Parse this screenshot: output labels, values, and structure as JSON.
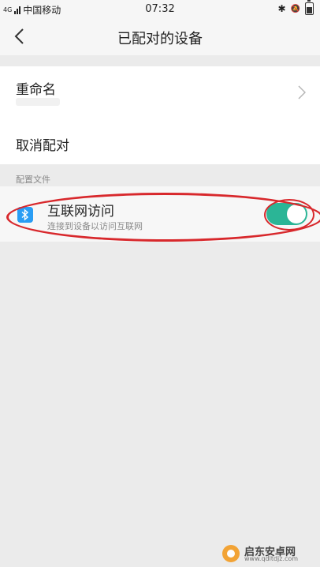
{
  "status_bar": {
    "network_type": "4G",
    "carrier": "中国移动",
    "time": "07:32",
    "bluetooth_glyph": "✱",
    "mute_glyph": "🔕"
  },
  "header": {
    "title": "已配对的设备"
  },
  "device_settings": {
    "rename_label": "重命名",
    "unpair_label": "取消配对"
  },
  "profiles": {
    "section_title": "配置文件",
    "internet_access": {
      "label": "互联网访问",
      "description": "连接到设备以访问互联网",
      "enabled": true
    }
  },
  "watermark": {
    "name": "启东安卓网",
    "url": "www.qdltdjz.com"
  },
  "colors": {
    "toggle_on": "#2bb596",
    "bluetooth_icon": "#2a9df4",
    "annotation": "#d8282c",
    "background": "#ebebeb"
  }
}
